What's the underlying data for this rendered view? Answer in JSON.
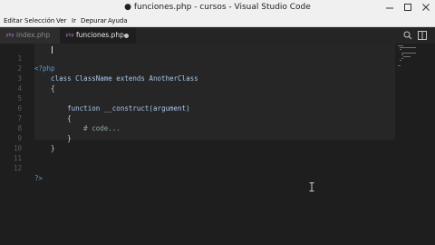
{
  "window": {
    "title": "● funciones.php - cursos - Visual Studio Code",
    "controls": [
      "minimize-icon",
      "maximize-icon",
      "close-icon"
    ]
  },
  "menu": {
    "items": [
      "Editar",
      "Selección",
      "Ver",
      "Ir",
      "Depurar",
      "Ayuda"
    ]
  },
  "tabs": [
    {
      "label": "index.php",
      "icon": "php-file-icon",
      "active": false
    },
    {
      "label": "funciones.php",
      "icon": "php-file-icon",
      "active": true,
      "dirty": true
    }
  ],
  "file_icon_text": "php",
  "editor_actions": [
    "split-editor-icon",
    "open-preview-icon"
  ],
  "editor": {
    "lines": [
      {
        "n": "1",
        "text": "<?php"
      },
      {
        "n": "2",
        "text": "    class ClassName extends AnotherClass"
      },
      {
        "n": "3",
        "text": "    {"
      },
      {
        "n": "4",
        "text": ""
      },
      {
        "n": "5",
        "text": "        function __construct(argument)"
      },
      {
        "n": "6",
        "text": "        {"
      },
      {
        "n": "7",
        "text": "            # code..."
      },
      {
        "n": "8",
        "text": "        }"
      },
      {
        "n": "9",
        "text": "    }"
      },
      {
        "n": "10",
        "text": ""
      },
      {
        "n": "11",
        "text": ""
      },
      {
        "n": "12",
        "text": "?>"
      }
    ]
  },
  "colors": {
    "editor_bg": "#1e1e1e",
    "titlebar_bg": "#f0f0f0",
    "keyword": "#569cd6",
    "class": "#4ec9b0",
    "function": "#dcdcaa",
    "comment": "#8fa89a"
  }
}
